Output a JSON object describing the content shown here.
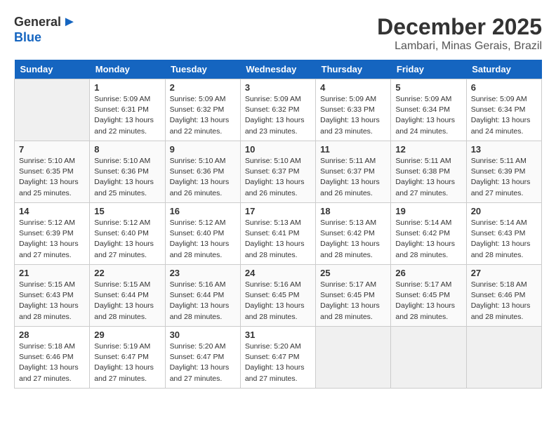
{
  "header": {
    "logo_general": "General",
    "logo_blue": "Blue",
    "month": "December 2025",
    "location": "Lambari, Minas Gerais, Brazil"
  },
  "weekdays": [
    "Sunday",
    "Monday",
    "Tuesday",
    "Wednesday",
    "Thursday",
    "Friday",
    "Saturday"
  ],
  "weeks": [
    [
      {
        "day": "",
        "empty": true
      },
      {
        "day": "1",
        "sunrise": "5:09 AM",
        "sunset": "6:31 PM",
        "daylight": "13 hours and 22 minutes."
      },
      {
        "day": "2",
        "sunrise": "5:09 AM",
        "sunset": "6:32 PM",
        "daylight": "13 hours and 22 minutes."
      },
      {
        "day": "3",
        "sunrise": "5:09 AM",
        "sunset": "6:32 PM",
        "daylight": "13 hours and 23 minutes."
      },
      {
        "day": "4",
        "sunrise": "5:09 AM",
        "sunset": "6:33 PM",
        "daylight": "13 hours and 23 minutes."
      },
      {
        "day": "5",
        "sunrise": "5:09 AM",
        "sunset": "6:34 PM",
        "daylight": "13 hours and 24 minutes."
      },
      {
        "day": "6",
        "sunrise": "5:09 AM",
        "sunset": "6:34 PM",
        "daylight": "13 hours and 24 minutes."
      }
    ],
    [
      {
        "day": "7",
        "sunrise": "5:10 AM",
        "sunset": "6:35 PM",
        "daylight": "13 hours and 25 minutes."
      },
      {
        "day": "8",
        "sunrise": "5:10 AM",
        "sunset": "6:36 PM",
        "daylight": "13 hours and 25 minutes."
      },
      {
        "day": "9",
        "sunrise": "5:10 AM",
        "sunset": "6:36 PM",
        "daylight": "13 hours and 26 minutes."
      },
      {
        "day": "10",
        "sunrise": "5:10 AM",
        "sunset": "6:37 PM",
        "daylight": "13 hours and 26 minutes."
      },
      {
        "day": "11",
        "sunrise": "5:11 AM",
        "sunset": "6:37 PM",
        "daylight": "13 hours and 26 minutes."
      },
      {
        "day": "12",
        "sunrise": "5:11 AM",
        "sunset": "6:38 PM",
        "daylight": "13 hours and 27 minutes."
      },
      {
        "day": "13",
        "sunrise": "5:11 AM",
        "sunset": "6:39 PM",
        "daylight": "13 hours and 27 minutes."
      }
    ],
    [
      {
        "day": "14",
        "sunrise": "5:12 AM",
        "sunset": "6:39 PM",
        "daylight": "13 hours and 27 minutes."
      },
      {
        "day": "15",
        "sunrise": "5:12 AM",
        "sunset": "6:40 PM",
        "daylight": "13 hours and 27 minutes."
      },
      {
        "day": "16",
        "sunrise": "5:12 AM",
        "sunset": "6:40 PM",
        "daylight": "13 hours and 28 minutes."
      },
      {
        "day": "17",
        "sunrise": "5:13 AM",
        "sunset": "6:41 PM",
        "daylight": "13 hours and 28 minutes."
      },
      {
        "day": "18",
        "sunrise": "5:13 AM",
        "sunset": "6:42 PM",
        "daylight": "13 hours and 28 minutes."
      },
      {
        "day": "19",
        "sunrise": "5:14 AM",
        "sunset": "6:42 PM",
        "daylight": "13 hours and 28 minutes."
      },
      {
        "day": "20",
        "sunrise": "5:14 AM",
        "sunset": "6:43 PM",
        "daylight": "13 hours and 28 minutes."
      }
    ],
    [
      {
        "day": "21",
        "sunrise": "5:15 AM",
        "sunset": "6:43 PM",
        "daylight": "13 hours and 28 minutes."
      },
      {
        "day": "22",
        "sunrise": "5:15 AM",
        "sunset": "6:44 PM",
        "daylight": "13 hours and 28 minutes."
      },
      {
        "day": "23",
        "sunrise": "5:16 AM",
        "sunset": "6:44 PM",
        "daylight": "13 hours and 28 minutes."
      },
      {
        "day": "24",
        "sunrise": "5:16 AM",
        "sunset": "6:45 PM",
        "daylight": "13 hours and 28 minutes."
      },
      {
        "day": "25",
        "sunrise": "5:17 AM",
        "sunset": "6:45 PM",
        "daylight": "13 hours and 28 minutes."
      },
      {
        "day": "26",
        "sunrise": "5:17 AM",
        "sunset": "6:45 PM",
        "daylight": "13 hours and 28 minutes."
      },
      {
        "day": "27",
        "sunrise": "5:18 AM",
        "sunset": "6:46 PM",
        "daylight": "13 hours and 28 minutes."
      }
    ],
    [
      {
        "day": "28",
        "sunrise": "5:18 AM",
        "sunset": "6:46 PM",
        "daylight": "13 hours and 27 minutes."
      },
      {
        "day": "29",
        "sunrise": "5:19 AM",
        "sunset": "6:47 PM",
        "daylight": "13 hours and 27 minutes."
      },
      {
        "day": "30",
        "sunrise": "5:20 AM",
        "sunset": "6:47 PM",
        "daylight": "13 hours and 27 minutes."
      },
      {
        "day": "31",
        "sunrise": "5:20 AM",
        "sunset": "6:47 PM",
        "daylight": "13 hours and 27 minutes."
      },
      {
        "day": "",
        "empty": true
      },
      {
        "day": "",
        "empty": true
      },
      {
        "day": "",
        "empty": true
      }
    ]
  ]
}
